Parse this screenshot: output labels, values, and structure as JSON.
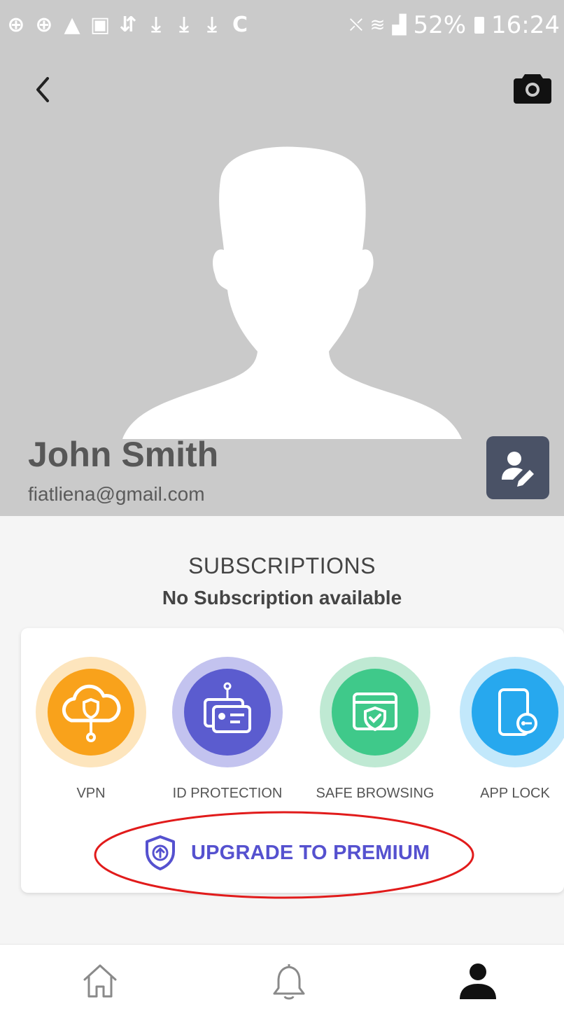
{
  "status_bar": {
    "left_icons": [
      "⊕",
      "⊕",
      "▲",
      "▣",
      "⇵",
      "⤓",
      "⤓",
      "⤓",
      "C"
    ],
    "battery_percent": "52%",
    "time": "16:24"
  },
  "header": {
    "back_icon": "chevron-left-icon",
    "camera_icon": "camera-icon",
    "background_color": "#cacaca"
  },
  "profile": {
    "name": "John Smith",
    "email": "fiatliena@gmail.com",
    "edit_icon": "edit-profile-icon"
  },
  "subscriptions": {
    "title": "SUBSCRIPTIONS",
    "status": "No Subscription available",
    "features": [
      {
        "label": "VPN",
        "icon": "vpn-cloud-shield-icon",
        "color": "#f9a21b"
      },
      {
        "label": "ID PROTECTION",
        "icon": "id-card-icon",
        "color": "#5b5ccf"
      },
      {
        "label": "SAFE BROWSING",
        "icon": "browser-shield-icon",
        "color": "#3fc98a"
      },
      {
        "label": "APP LOCK",
        "icon": "phone-key-icon",
        "color": "#27a8ee"
      }
    ],
    "upgrade_label": "UPGRADE TO PREMIUM",
    "upgrade_icon": "shield-up-arrow-icon",
    "accent_color": "#5551cf",
    "highlight_color": "#e11b1b"
  },
  "bottom_nav": {
    "items": [
      {
        "icon": "home-icon",
        "active": false
      },
      {
        "icon": "bell-icon",
        "active": false
      },
      {
        "icon": "user-icon",
        "active": true
      }
    ]
  }
}
